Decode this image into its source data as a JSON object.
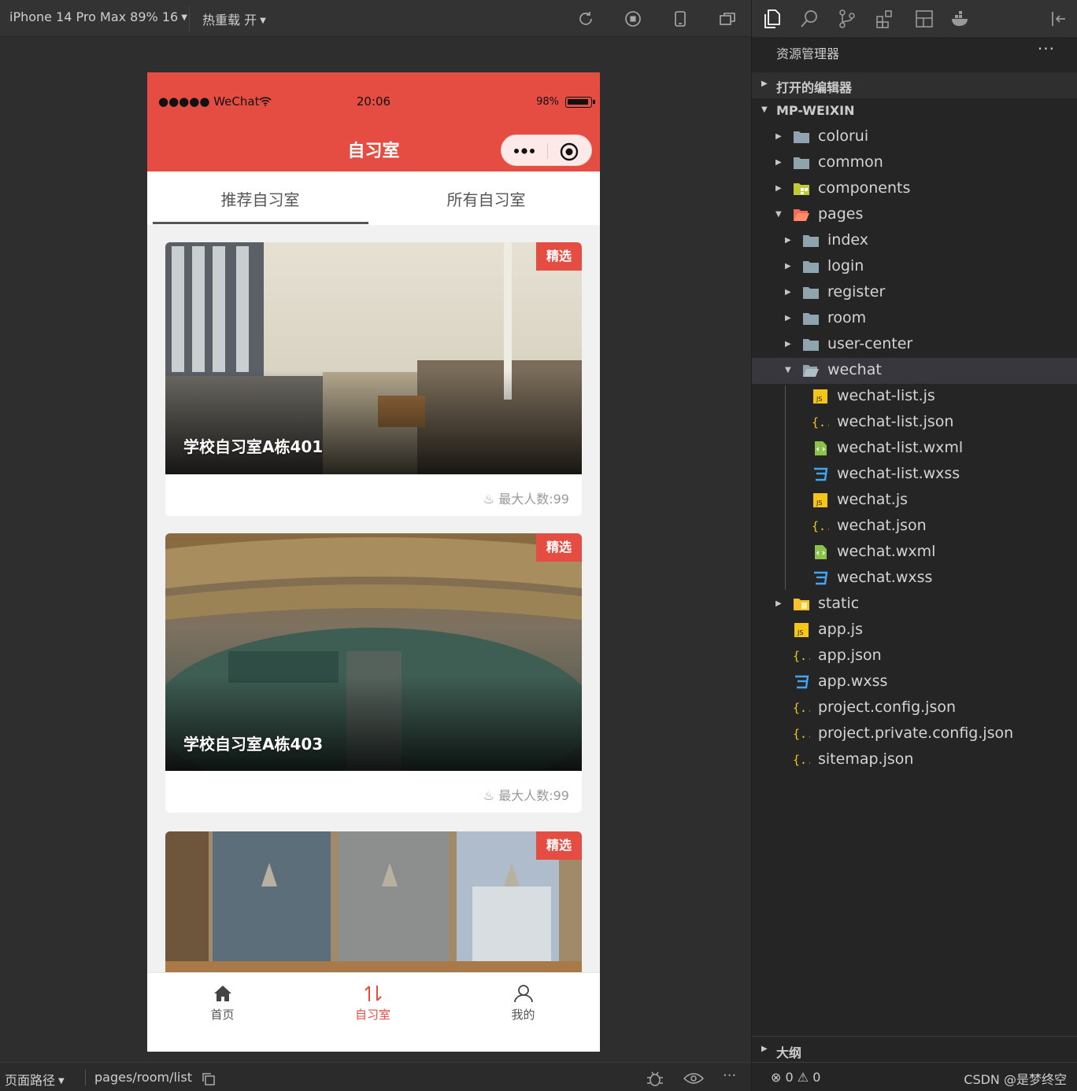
{
  "simulator": {
    "device_label": "iPhone 14 Pro Max 89% 16",
    "hot_reload_label": "热重载 开",
    "page_path_label": "页面路径",
    "page_path_value": "pages/room/list"
  },
  "phone": {
    "status": {
      "carrier": "●●●●● WeChat",
      "time": "20:06",
      "battery": "98%"
    },
    "nav_title": "自习室",
    "tabs": [
      {
        "label": "推荐自习室",
        "active": true
      },
      {
        "label": "所有自习室",
        "active": false
      }
    ],
    "cards": [
      {
        "badge": "精选",
        "title": "学校自习室A栋401",
        "capacity": "最大人数:99"
      },
      {
        "badge": "精选",
        "title": "学校自习室A栋403",
        "capacity": "最大人数:99"
      },
      {
        "badge": "精选",
        "title": "",
        "capacity": ""
      }
    ],
    "tabbar": [
      {
        "label": "首页",
        "icon": "home-icon",
        "active": false
      },
      {
        "label": "自习室",
        "icon": "sort-arrows-icon",
        "active": true
      },
      {
        "label": "我的",
        "icon": "user-icon",
        "active": false
      }
    ],
    "accent_color": "#e54d42"
  },
  "explorer": {
    "header": "资源管理器",
    "more": "···",
    "open_editors": "打开的编辑器",
    "project": "MP-WEIXIN",
    "tree": [
      {
        "label": "colorui",
        "type": "folder"
      },
      {
        "label": "common",
        "type": "folder"
      },
      {
        "label": "components",
        "type": "folder-components"
      },
      {
        "label": "pages",
        "type": "folder-pages"
      },
      {
        "label": "index",
        "type": "folder"
      },
      {
        "label": "login",
        "type": "folder"
      },
      {
        "label": "register",
        "type": "folder"
      },
      {
        "label": "room",
        "type": "folder"
      },
      {
        "label": "user-center",
        "type": "folder"
      },
      {
        "label": "wechat",
        "type": "folder-open"
      },
      {
        "label": "wechat-list.js",
        "type": "js"
      },
      {
        "label": "wechat-list.json",
        "type": "json"
      },
      {
        "label": "wechat-list.wxml",
        "type": "wxml"
      },
      {
        "label": "wechat-list.wxss",
        "type": "wxss"
      },
      {
        "label": "wechat.js",
        "type": "js"
      },
      {
        "label": "wechat.json",
        "type": "json"
      },
      {
        "label": "wechat.wxml",
        "type": "wxml"
      },
      {
        "label": "wechat.wxss",
        "type": "wxss"
      },
      {
        "label": "static",
        "type": "folder-static"
      },
      {
        "label": "app.js",
        "type": "js"
      },
      {
        "label": "app.json",
        "type": "json"
      },
      {
        "label": "app.wxss",
        "type": "wxss"
      },
      {
        "label": "project.config.json",
        "type": "json"
      },
      {
        "label": "project.private.config.json",
        "type": "json"
      },
      {
        "label": "sitemap.json",
        "type": "json"
      }
    ],
    "outline": "大纲",
    "errors": "0",
    "warnings": "0",
    "credit": "CSDN @是梦终空"
  }
}
